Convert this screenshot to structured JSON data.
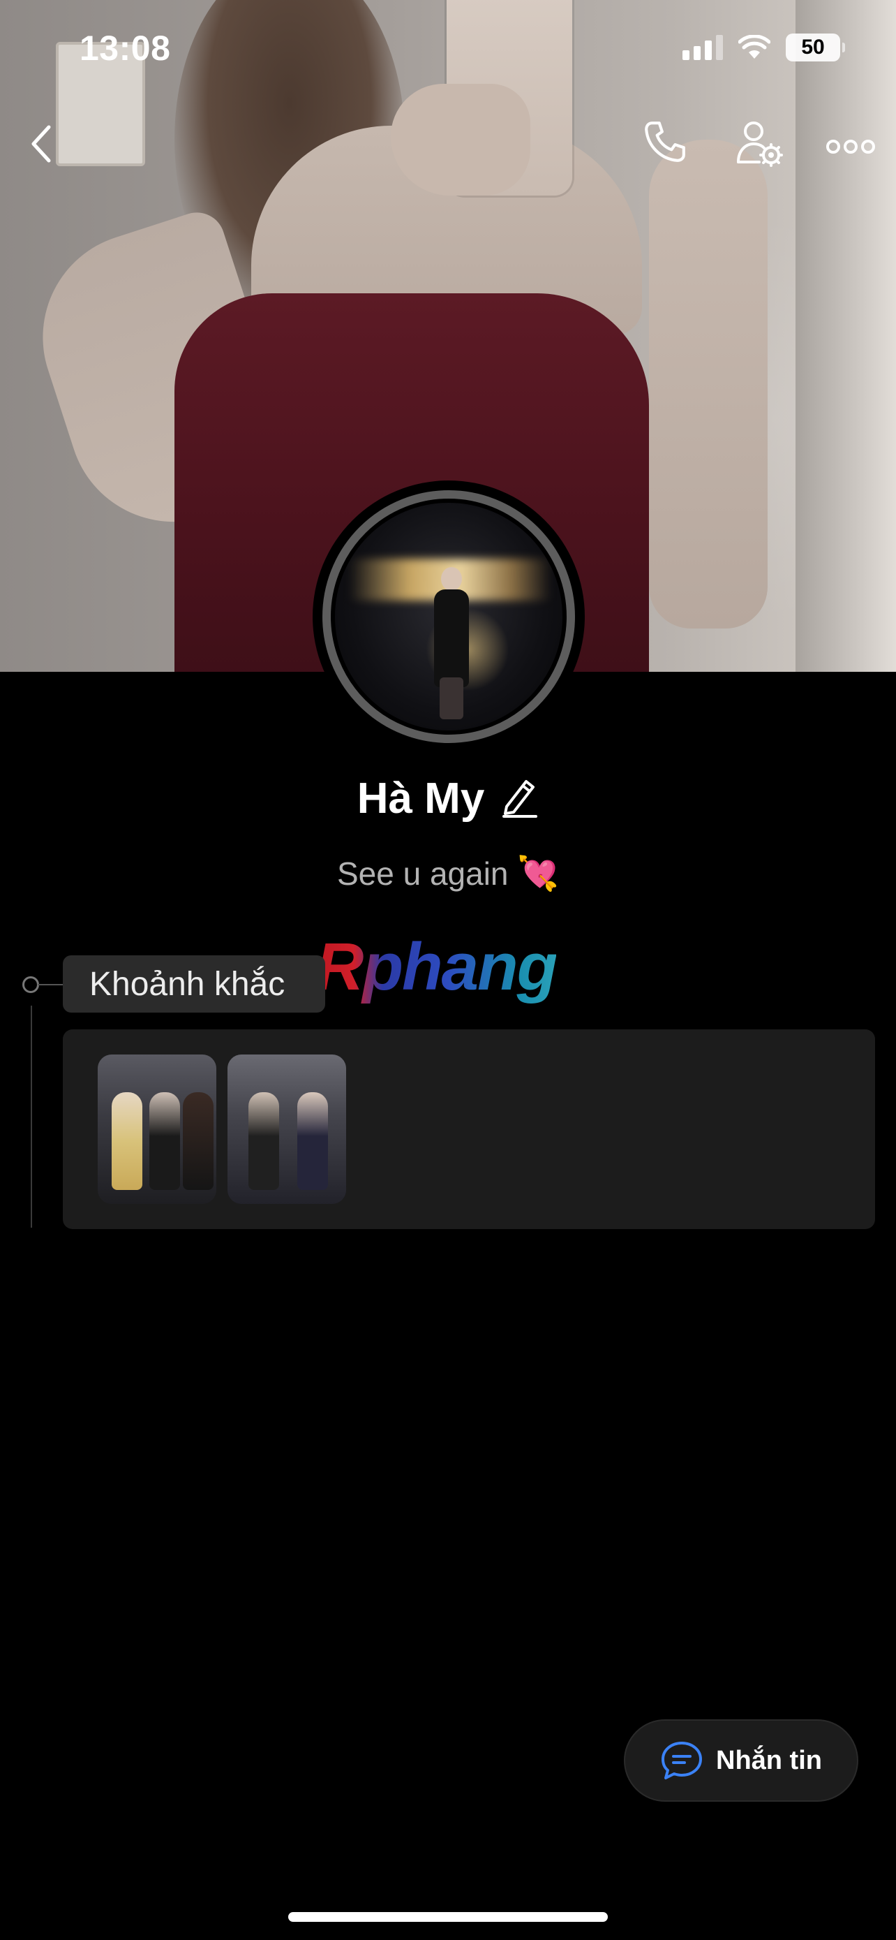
{
  "status_bar": {
    "time": "13:08",
    "battery": "50"
  },
  "header": {
    "back_icon": "chevron-left-icon",
    "call_icon": "phone-icon",
    "profile_settings_icon": "user-gear-icon",
    "more_icon": "more-horizontal-icon"
  },
  "profile": {
    "name": "Hà My",
    "edit_icon": "pencil-icon",
    "bio": "See u again",
    "bio_emoji": "💘"
  },
  "watermark": "Rphang",
  "moments": {
    "label": "Khoảnh khắc",
    "items": [
      {
        "kind": "photo"
      },
      {
        "kind": "photo"
      }
    ]
  },
  "message_button": {
    "label": "Nhắn tin",
    "icon": "chat-bubble-icon"
  },
  "colors": {
    "background": "#000000",
    "accent": "#3b82f6",
    "card": "#1c1c1c"
  }
}
